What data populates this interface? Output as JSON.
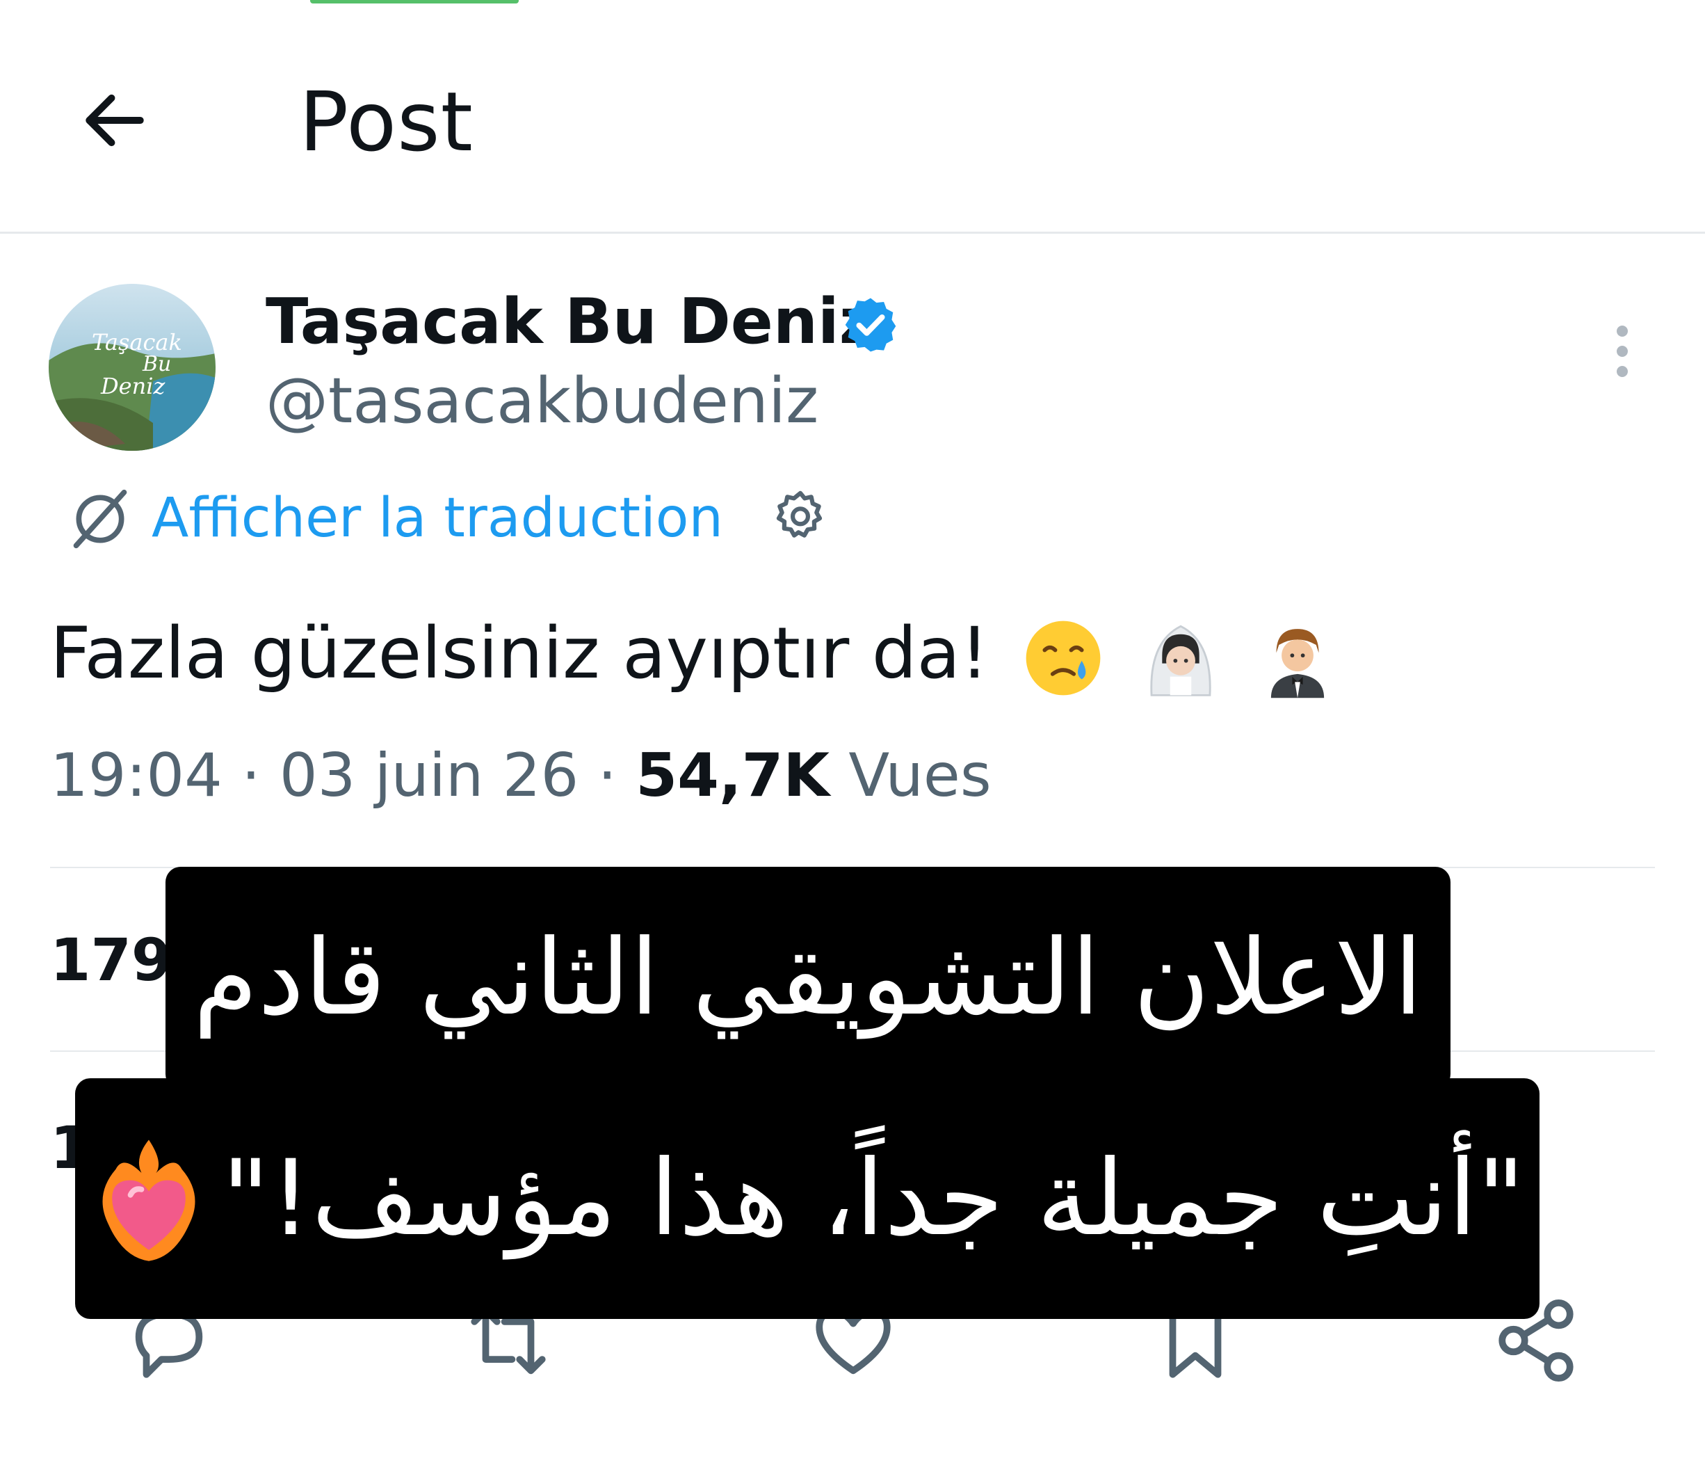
{
  "header": {
    "title": "Post"
  },
  "post": {
    "author": {
      "display_name": "Taşacak Bu Deniz",
      "handle": "@tasacakbudeniz",
      "verified": true,
      "avatar_text": [
        "Taşacak",
        "Bu",
        "Deniz"
      ]
    },
    "translate_label": "Afficher la traduction",
    "text": "Fazla güzelsiniz ayıptır da!",
    "emojis": [
      "face-holding-back-tears",
      "bride-with-veil",
      "man-in-tuxedo"
    ],
    "time": "19:04",
    "date": "03 juin 26",
    "separator": "·",
    "views_count": "54,7K",
    "views_label": "Vues",
    "stats": {
      "row1_count": "179",
      "row2_count": "1"
    },
    "actions": [
      "reply-icon",
      "repost-icon",
      "like-icon",
      "bookmark-icon",
      "share-icon"
    ]
  },
  "overlay": {
    "line1": "الاعلان التشويقي الثاني قادم",
    "line2": "\"أنتِ جميلة جداً، هذا مؤسف!\""
  },
  "colors": {
    "link": "#1d9bf0",
    "secondary_text": "#536471",
    "primary_text": "#0f1419",
    "verified_badge": "#1d9bf0",
    "overlay_bg": "#000000"
  }
}
